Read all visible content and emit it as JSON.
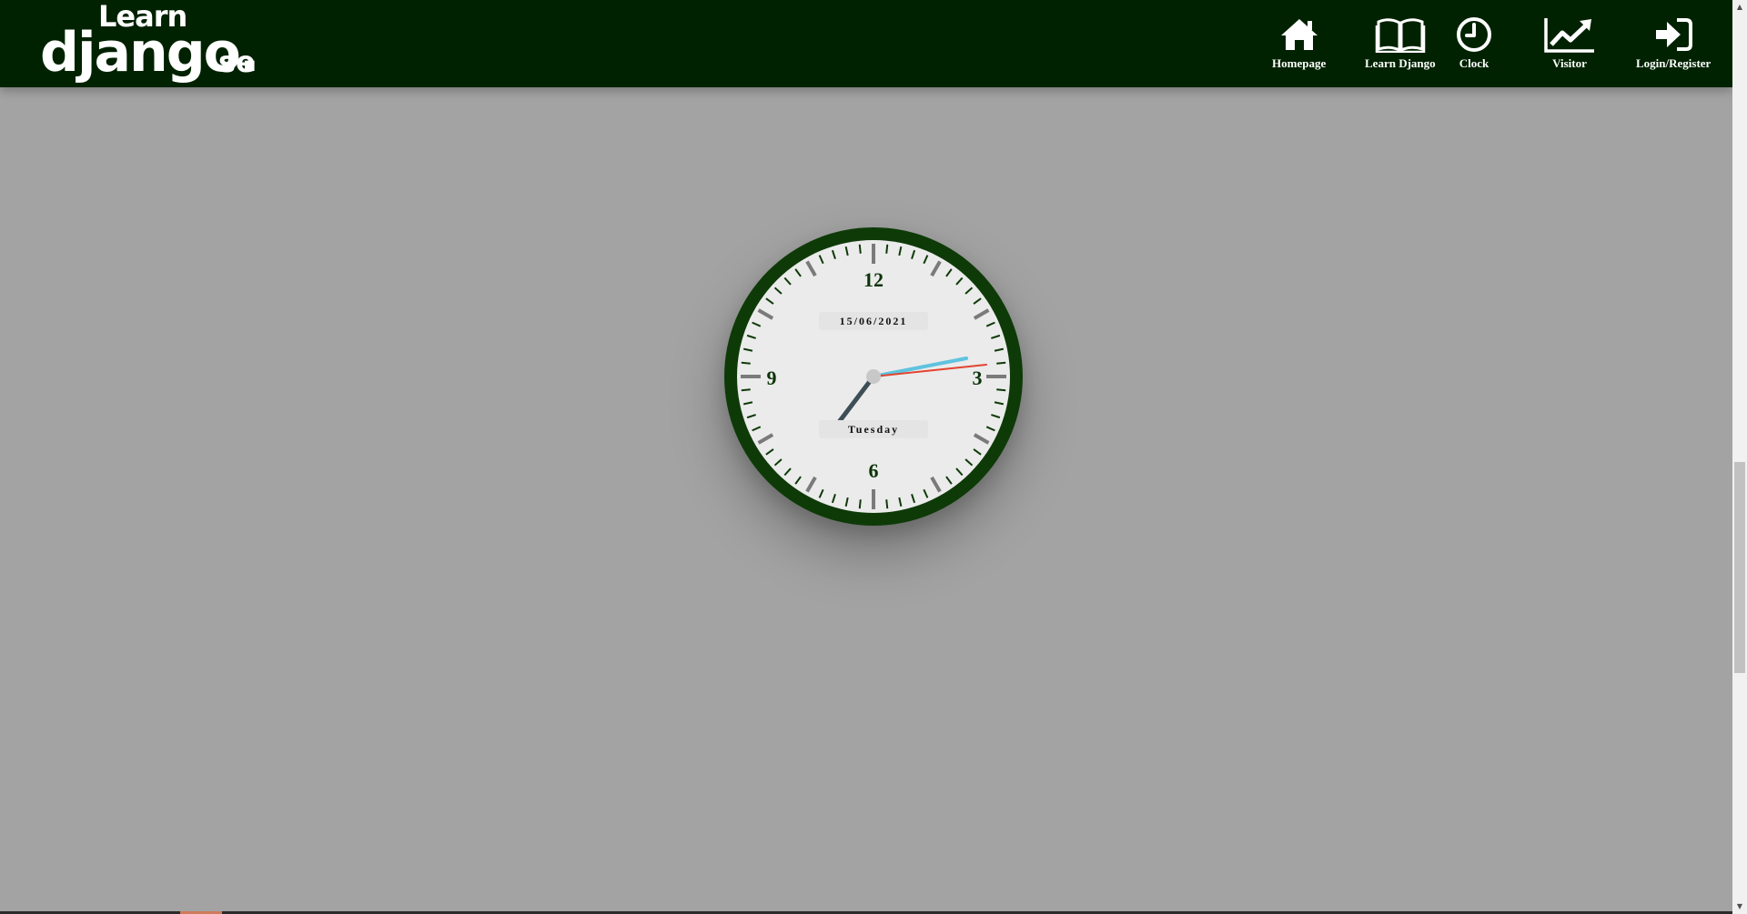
{
  "header": {
    "logo": {
      "line1": "Learn",
      "line2": "django.",
      "line3": "se"
    },
    "nav": [
      {
        "label": "Homepage",
        "icon": "home-icon"
      },
      {
        "label": "Learn Django",
        "icon": "book-icon"
      },
      {
        "label": "Clock",
        "icon": "clock-icon"
      },
      {
        "label": "Visitor",
        "icon": "trend-chart-icon"
      },
      {
        "label": "Login/Register",
        "icon": "sign-in-icon"
      }
    ]
  },
  "clock": {
    "numerals": {
      "twelve": "12",
      "three": "3",
      "six": "6",
      "nine": "9"
    },
    "date": "15/06/2021",
    "day": "Tuesday",
    "colors": {
      "rim": "#0e3a08",
      "face": "#ebebeb",
      "hour_hand": "#3d4e57",
      "minute_hand": "#5fc3df",
      "second_hand": "#e2442f",
      "numerals": "#0b3308"
    }
  },
  "colors": {
    "header_bg": "#002200",
    "page_bg": "#a3a3a3"
  }
}
